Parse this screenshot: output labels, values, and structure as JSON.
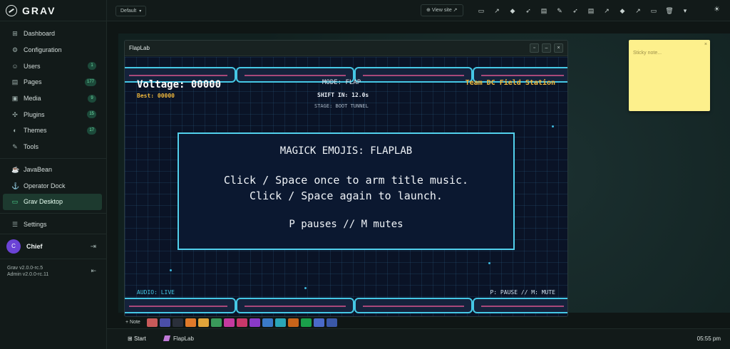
{
  "brand": {
    "name": "GRAV"
  },
  "sidebar": {
    "items": [
      {
        "label": "Dashboard",
        "icon": "dashboard-icon",
        "count": ""
      },
      {
        "label": "Configuration",
        "icon": "gear-icon",
        "count": ""
      },
      {
        "label": "Users",
        "icon": "users-icon",
        "count": "1"
      },
      {
        "label": "Pages",
        "icon": "pages-icon",
        "count": "177"
      },
      {
        "label": "Media",
        "icon": "media-icon",
        "count": "9"
      },
      {
        "label": "Plugins",
        "icon": "plugin-icon",
        "count": "15"
      },
      {
        "label": "Themes",
        "icon": "palette-icon",
        "count": "17"
      },
      {
        "label": "Tools",
        "icon": "wrench-icon",
        "count": ""
      }
    ],
    "extras": [
      {
        "label": "JavaBean",
        "icon": "coffee-icon"
      },
      {
        "label": "Operator Dock",
        "icon": "dock-icon"
      },
      {
        "label": "Grav Desktop",
        "icon": "desktop-icon"
      }
    ],
    "settings": {
      "label": "Settings"
    },
    "user": {
      "initial": "C",
      "name": "Chief"
    },
    "version": {
      "grav": "Grav v2.0.0-rc.5",
      "admin": "Admin v2.0.0-rc.11"
    }
  },
  "topbar": {
    "environment": "Default",
    "view_site": "View site"
  },
  "sticky": {
    "placeholder": "Sticky note..."
  },
  "window": {
    "title": "FlapLab",
    "game": {
      "voltage": "Voltage: 00000",
      "best": "Best: 00000",
      "mode": "MODE: FLAP",
      "team": "Team DC Field Station",
      "shift": "SHIFT IN: 12.0s",
      "stage": "STAGE: BOOT TUNNEL",
      "audio": "AUDIO: LIVE",
      "controls": "P: PAUSE // M: MUTE",
      "dialog": {
        "title": "MAGICK EMOJIS: FLAPLAB",
        "line1": "Click / Space once to arm title music.",
        "line2": "Click / Space again to launch.",
        "line3": "P pauses // M mutes"
      }
    }
  },
  "palette": {
    "note_label": "+ Note",
    "colors": [
      "#c85a5a",
      "#4a4ea8",
      "#2a2f3a",
      "#e07a2a",
      "#e0a43a",
      "#3a9a5a",
      "#c43aa0",
      "#c8386a",
      "#8a3ac8",
      "#3a7ac8",
      "#2aa6b8",
      "#c8641a",
      "#1aa04a",
      "#4a6ac8",
      "#3a58a8"
    ]
  },
  "taskbar": {
    "start": "Start",
    "task": "FlapLab",
    "time": "05:55 pm"
  },
  "colors": {
    "accent": "#4fdc92",
    "game_cyan": "#45c8e6",
    "game_gold": "#f0b83c"
  }
}
